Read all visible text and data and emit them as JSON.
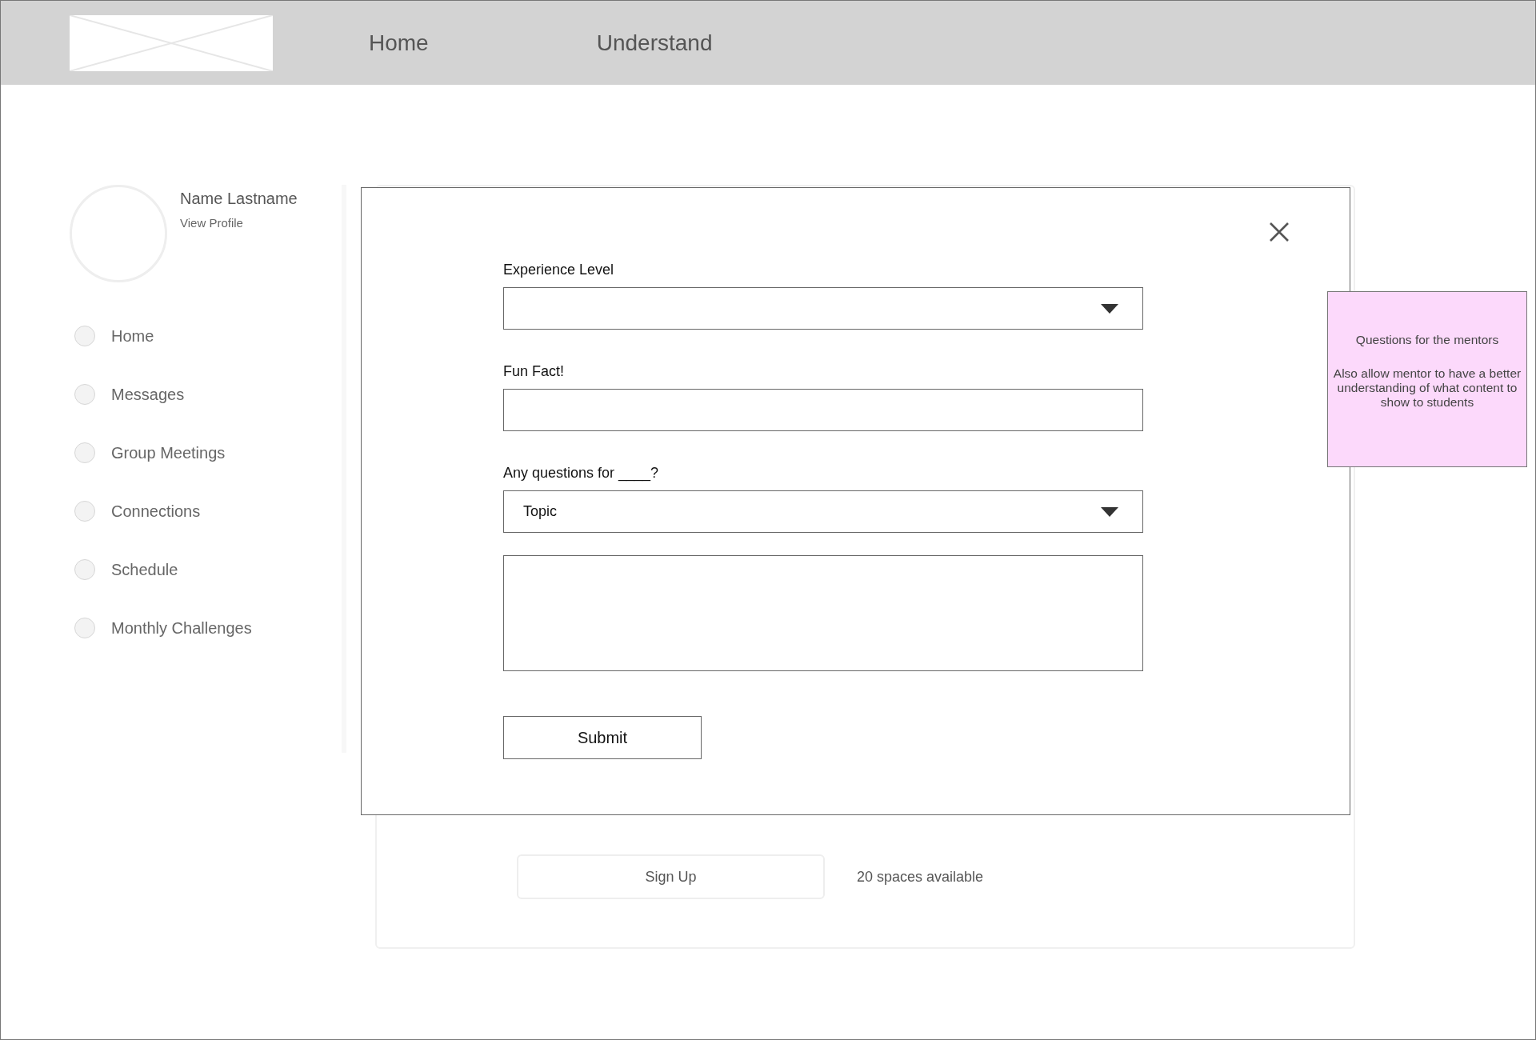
{
  "header": {
    "nav": [
      {
        "label": "Home"
      },
      {
        "label": "Understand"
      }
    ]
  },
  "profile": {
    "name": "Name Lastname",
    "link": "View Profile"
  },
  "sidebar": {
    "items": [
      {
        "label": "Home"
      },
      {
        "label": "Messages"
      },
      {
        "label": "Group Meetings"
      },
      {
        "label": "Connections"
      },
      {
        "label": "Schedule"
      },
      {
        "label": "Monthly Challenges"
      }
    ]
  },
  "card": {
    "button": "Sign Up",
    "availability": "20 spaces available"
  },
  "modal": {
    "fields": [
      {
        "kind": "select",
        "label": "Experience Level"
      },
      {
        "kind": "input",
        "label": "Fun Fact!"
      },
      {
        "kind": "select",
        "label": "Any questions for ____?",
        "value": "Topic"
      },
      {
        "kind": "textarea"
      }
    ],
    "submit": "Submit"
  },
  "note": {
    "lines": [
      "Questions for the mentors",
      "Also allow mentor to have a better understanding of what content to show to students"
    ]
  }
}
